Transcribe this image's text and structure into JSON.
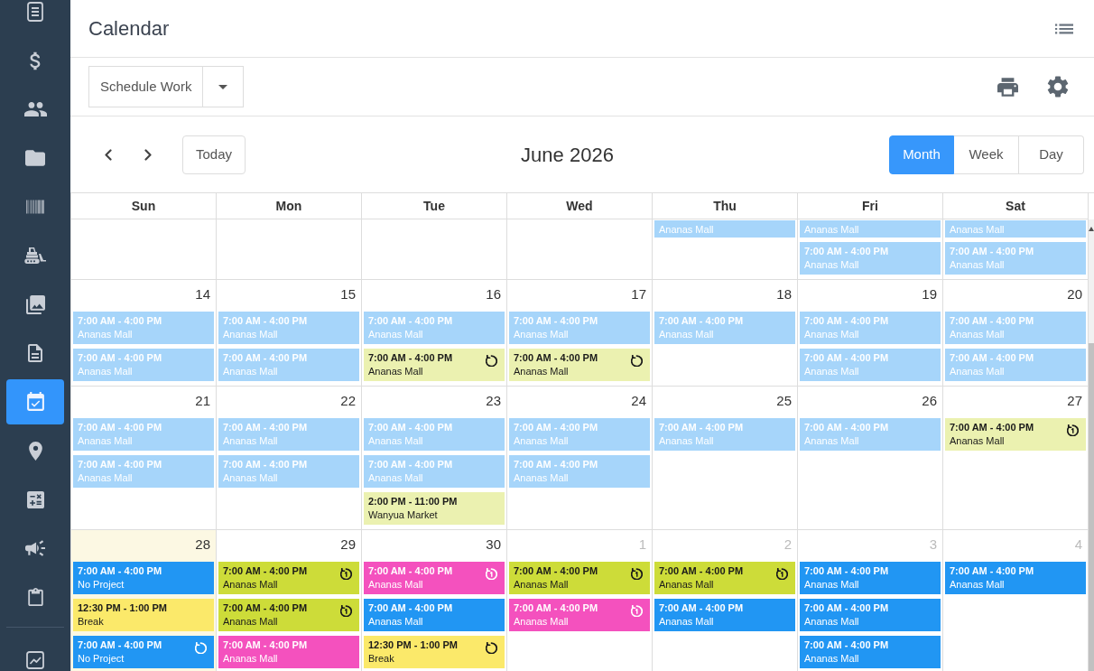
{
  "sidebar": {
    "items": [
      {
        "selected": false
      },
      {
        "selected": false
      },
      {
        "selected": false
      },
      {
        "selected": false
      },
      {
        "selected": false
      },
      {
        "selected": false
      },
      {
        "selected": false
      },
      {
        "selected": false
      },
      {
        "selected": true
      },
      {
        "selected": false
      },
      {
        "selected": false
      },
      {
        "selected": false
      },
      {
        "selected": false
      }
    ],
    "bottom_items": [
      {
        "selected": false
      }
    ]
  },
  "header": {
    "title": "Calendar"
  },
  "toolbar": {
    "dropdown": {
      "label": "Schedule Work"
    }
  },
  "navigation": {
    "today_button": "Today",
    "title": "June 2026",
    "views": [
      {
        "label": "Month",
        "selected": true
      },
      {
        "label": "Week",
        "selected": false
      },
      {
        "label": "Day",
        "selected": false
      }
    ]
  },
  "calendar": {
    "weekdays": [
      "Sun",
      "Mon",
      "Tue",
      "Wed",
      "Thu",
      "Fri",
      "Sat"
    ],
    "partial_week": {
      "thu": {
        "events": [
          {
            "kind": "partial",
            "location": "Ananas Mall",
            "color": "#a6d5fa"
          }
        ]
      },
      "fri": {
        "events": [
          {
            "kind": "partial",
            "location": "Ananas Mall",
            "color": "#a6d5fa"
          },
          {
            "kind": "plain",
            "time": "7:00 AM - 4:00 PM",
            "location": "Ananas Mall",
            "color": "#a6d5fa"
          }
        ]
      },
      "sat": {
        "events": [
          {
            "kind": "partial",
            "location": "Ananas Mall",
            "color": "#a6d5fa"
          },
          {
            "kind": "plain",
            "time": "7:00 AM - 4:00 PM",
            "location": "Ananas Mall",
            "color": "#a6d5fa"
          }
        ]
      }
    },
    "weeks": [
      {
        "days": [
          {
            "date": "14",
            "today": false,
            "muted": false,
            "events": [
              {
                "kind": "plain",
                "time": "7:00 AM - 4:00 PM",
                "location": "Ananas Mall",
                "color": "#a6d5fa"
              },
              {
                "kind": "plain",
                "time": "7:00 AM - 4:00 PM",
                "location": "Ananas Mall",
                "color": "#a6d5fa"
              }
            ]
          },
          {
            "date": "15",
            "today": false,
            "muted": false,
            "events": [
              {
                "kind": "plain",
                "time": "7:00 AM - 4:00 PM",
                "location": "Ananas Mall",
                "color": "#a6d5fa"
              },
              {
                "kind": "plain",
                "time": "7:00 AM - 4:00 PM",
                "location": "Ananas Mall",
                "color": "#a6d5fa"
              }
            ]
          },
          {
            "date": "16",
            "today": false,
            "muted": false,
            "events": [
              {
                "kind": "plain",
                "time": "7:00 AM - 4:00 PM",
                "location": "Ananas Mall",
                "color": "#a6d5fa"
              },
              {
                "kind": "repeat",
                "time": "7:00 AM - 4:00 PM",
                "location": "Ananas Mall",
                "color": "#ebf1b0"
              }
            ]
          },
          {
            "date": "17",
            "today": false,
            "muted": false,
            "events": [
              {
                "kind": "plain",
                "time": "7:00 AM - 4:00 PM",
                "location": "Ananas Mall",
                "color": "#a6d5fa"
              },
              {
                "kind": "repeat",
                "time": "7:00 AM - 4:00 PM",
                "location": "Ananas Mall",
                "color": "#ebf1b0"
              }
            ]
          },
          {
            "date": "18",
            "today": false,
            "muted": false,
            "events": [
              {
                "kind": "plain",
                "time": "7:00 AM - 4:00 PM",
                "location": "Ananas Mall",
                "color": "#a6d5fa"
              }
            ]
          },
          {
            "date": "19",
            "today": false,
            "muted": false,
            "events": [
              {
                "kind": "plain",
                "time": "7:00 AM - 4:00 PM",
                "location": "Ananas Mall",
                "color": "#a6d5fa"
              },
              {
                "kind": "plain",
                "time": "7:00 AM - 4:00 PM",
                "location": "Ananas Mall",
                "color": "#a6d5fa"
              }
            ]
          },
          {
            "date": "20",
            "today": false,
            "muted": false,
            "events": [
              {
                "kind": "plain",
                "time": "7:00 AM - 4:00 PM",
                "location": "Ananas Mall",
                "color": "#a6d5fa"
              },
              {
                "kind": "plain",
                "time": "7:00 AM - 4:00 PM",
                "location": "Ananas Mall",
                "color": "#a6d5fa"
              }
            ]
          }
        ]
      },
      {
        "days": [
          {
            "date": "21",
            "today": false,
            "muted": false,
            "events": [
              {
                "kind": "plain",
                "time": "7:00 AM - 4:00 PM",
                "location": "Ananas Mall",
                "color": "#a6d5fa"
              },
              {
                "kind": "plain",
                "time": "7:00 AM - 4:00 PM",
                "location": "Ananas Mall",
                "color": "#a6d5fa"
              }
            ]
          },
          {
            "date": "22",
            "today": false,
            "muted": false,
            "events": [
              {
                "kind": "plain",
                "time": "7:00 AM - 4:00 PM",
                "location": "Ananas Mall",
                "color": "#a6d5fa"
              },
              {
                "kind": "plain",
                "time": "7:00 AM - 4:00 PM",
                "location": "Ananas Mall",
                "color": "#a6d5fa"
              }
            ]
          },
          {
            "date": "23",
            "today": false,
            "muted": false,
            "events": [
              {
                "kind": "plain",
                "time": "7:00 AM - 4:00 PM",
                "location": "Ananas Mall",
                "color": "#a6d5fa"
              },
              {
                "kind": "plain",
                "time": "7:00 AM - 4:00 PM",
                "location": "Ananas Mall",
                "color": "#a6d5fa"
              },
              {
                "kind": "plain",
                "time": "2:00 PM - 11:00 PM",
                "location": "Wanyua Market",
                "color": "#ebf1b0"
              }
            ]
          },
          {
            "date": "24",
            "today": false,
            "muted": false,
            "events": [
              {
                "kind": "plain",
                "time": "7:00 AM - 4:00 PM",
                "location": "Ananas Mall",
                "color": "#a6d5fa"
              },
              {
                "kind": "plain",
                "time": "7:00 AM - 4:00 PM",
                "location": "Ananas Mall",
                "color": "#a6d5fa"
              }
            ]
          },
          {
            "date": "25",
            "today": false,
            "muted": false,
            "events": [
              {
                "kind": "plain",
                "time": "7:00 AM - 4:00 PM",
                "location": "Ananas Mall",
                "color": "#a6d5fa"
              }
            ]
          },
          {
            "date": "26",
            "today": false,
            "muted": false,
            "events": [
              {
                "kind": "plain",
                "time": "7:00 AM - 4:00 PM",
                "location": "Ananas Mall",
                "color": "#a6d5fa"
              }
            ]
          },
          {
            "date": "27",
            "today": false,
            "muted": false,
            "events": [
              {
                "kind": "repeat-one",
                "time": "7:00 AM - 4:00 PM",
                "location": "Ananas Mall",
                "color": "#ebf1b0"
              }
            ]
          }
        ]
      },
      {
        "days": [
          {
            "date": "28",
            "today": true,
            "muted": false,
            "events": [
              {
                "kind": "plain",
                "time": "7:00 AM - 4:00 PM",
                "location": "No Project",
                "color": "#2196f3"
              },
              {
                "kind": "plain",
                "time": "12:30 PM - 1:00 PM",
                "location": "Break",
                "color": "#fbe96a"
              },
              {
                "kind": "repeat",
                "time": "7:00 AM - 4:00 PM",
                "location": "No Project",
                "color": "#2196f3"
              }
            ]
          },
          {
            "date": "29",
            "today": false,
            "muted": false,
            "events": [
              {
                "kind": "repeat-one",
                "time": "7:00 AM - 4:00 PM",
                "location": "Ananas Mall",
                "color": "#cddc39"
              },
              {
                "kind": "repeat-one",
                "time": "7:00 AM - 4:00 PM",
                "location": "Ananas Mall",
                "color": "#cddc39"
              },
              {
                "kind": "plain",
                "time": "7:00 AM - 4:00 PM",
                "location": "Ananas Mall",
                "color": "#f451be"
              }
            ]
          },
          {
            "date": "30",
            "today": false,
            "muted": false,
            "events": [
              {
                "kind": "repeat-one",
                "time": "7:00 AM - 4:00 PM",
                "location": "Ananas Mall",
                "color": "#f451be"
              },
              {
                "kind": "plain",
                "time": "7:00 AM - 4:00 PM",
                "location": "Ananas Mall",
                "color": "#2196f3"
              },
              {
                "kind": "repeat",
                "time": "12:30 PM - 1:00 PM",
                "location": "Break",
                "color": "#fbe96a"
              }
            ]
          },
          {
            "date": "1",
            "today": false,
            "muted": true,
            "events": [
              {
                "kind": "repeat-one",
                "time": "7:00 AM - 4:00 PM",
                "location": "Ananas Mall",
                "color": "#cddc39"
              },
              {
                "kind": "repeat-one",
                "time": "7:00 AM - 4:00 PM",
                "location": "Ananas Mall",
                "color": "#f451be"
              }
            ]
          },
          {
            "date": "2",
            "today": false,
            "muted": true,
            "events": [
              {
                "kind": "repeat-one",
                "time": "7:00 AM - 4:00 PM",
                "location": "Ananas Mall",
                "color": "#cddc39"
              },
              {
                "kind": "plain",
                "time": "7:00 AM - 4:00 PM",
                "location": "Ananas Mall",
                "color": "#2196f3"
              }
            ]
          },
          {
            "date": "3",
            "today": false,
            "muted": true,
            "events": [
              {
                "kind": "plain",
                "time": "7:00 AM - 4:00 PM",
                "location": "Ananas Mall",
                "color": "#2196f3"
              },
              {
                "kind": "plain",
                "time": "7:00 AM - 4:00 PM",
                "location": "Ananas Mall",
                "color": "#2196f3"
              },
              {
                "kind": "plain",
                "time": "7:00 AM - 4:00 PM",
                "location": "Ananas Mall",
                "color": "#2196f3"
              }
            ]
          },
          {
            "date": "4",
            "today": false,
            "muted": true,
            "events": [
              {
                "kind": "plain",
                "time": "7:00 AM - 4:00 PM",
                "location": "Ananas Mall",
                "color": "#2196f3"
              }
            ]
          }
        ]
      }
    ]
  }
}
